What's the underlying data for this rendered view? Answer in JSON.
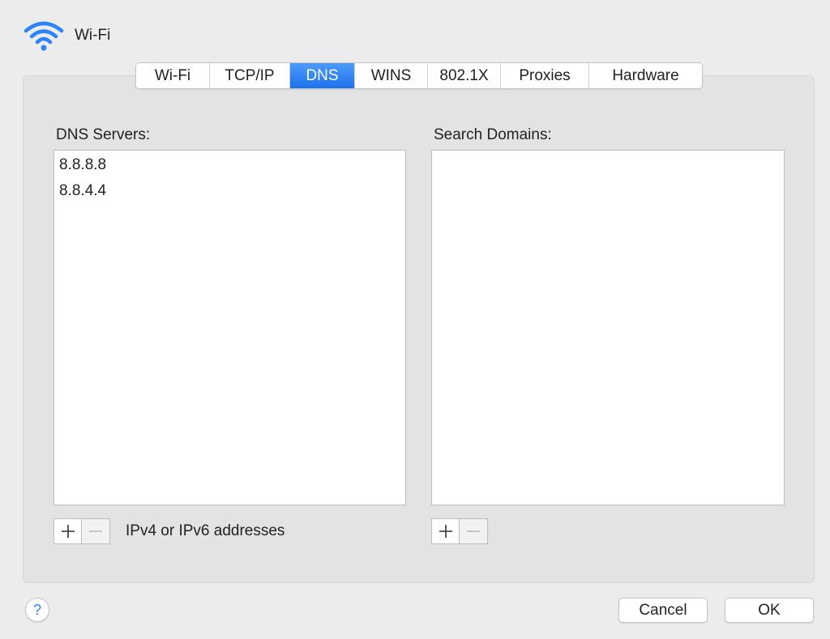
{
  "header": {
    "title": "Wi-Fi",
    "icon": "wifi-icon",
    "icon_color": "#2a84f7"
  },
  "tabs": [
    {
      "label": "Wi-Fi",
      "active": false
    },
    {
      "label": "TCP/IP",
      "active": false
    },
    {
      "label": "DNS",
      "active": true
    },
    {
      "label": "WINS",
      "active": false
    },
    {
      "label": "802.1X",
      "active": false
    },
    {
      "label": "Proxies",
      "active": false
    },
    {
      "label": "Hardware",
      "active": false
    }
  ],
  "dns": {
    "label": "DNS Servers:",
    "servers": [
      "8.8.8.8",
      "8.8.4.4"
    ],
    "hint": "IPv4 or IPv6 addresses",
    "add_enabled": true,
    "remove_enabled": false
  },
  "search": {
    "label": "Search Domains:",
    "domains": [],
    "add_enabled": true,
    "remove_enabled": false
  },
  "footer": {
    "help_label": "?",
    "cancel_label": "Cancel",
    "ok_label": "OK"
  },
  "colors": {
    "accent": "#1d72ee",
    "background": "#ececec",
    "panel": "#e3e3e3"
  }
}
